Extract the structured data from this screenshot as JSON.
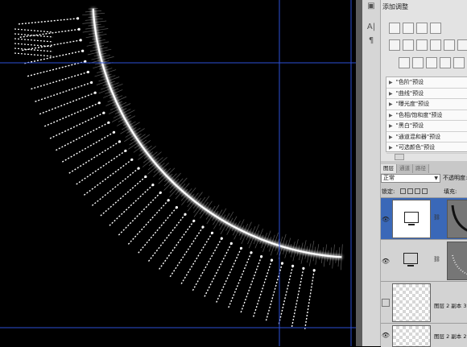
{
  "adjustments": {
    "title": "添加调整",
    "presets": [
      "\"色阶\"预设",
      "\"曲线\"预设",
      "\"曝光度\"预设",
      "\"色相/饱和度\"预设",
      "\"黑白\"预设",
      "\"通道混和器\"预设",
      "\"可选颜色\"预设"
    ]
  },
  "layers": {
    "tabs": [
      "图层",
      "通道",
      "路径"
    ],
    "blend_mode": "正常",
    "opacity_label": "不透明度:",
    "lock_label": "锁定:",
    "fill_label": "填充:",
    "items": [
      {
        "name": "",
        "visible": true,
        "selected": true
      },
      {
        "name": "",
        "visible": true,
        "selected": false
      },
      {
        "name": "图层 2 副本 3",
        "visible": false,
        "selected": false
      },
      {
        "name": "图层 2 副本 2",
        "visible": true,
        "selected": false
      }
    ]
  },
  "colors": {
    "canvas": "#000000",
    "guide": "#2d4fd6",
    "selection": "#3a68b8",
    "panel": "#e3e3e3"
  }
}
